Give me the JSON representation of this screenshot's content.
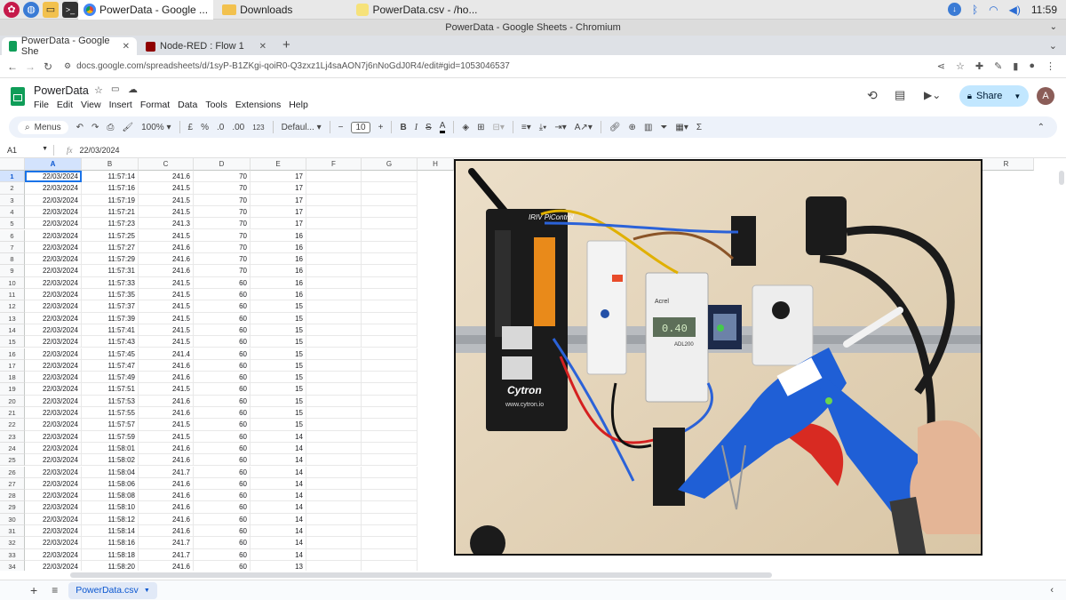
{
  "taskbar": {
    "tasks": [
      {
        "label": "PowerData - Google ...",
        "active": true
      },
      {
        "label": "Downloads",
        "active": false
      },
      {
        "label": "PowerData.csv - /ho...",
        "active": false
      }
    ],
    "clock": "11:59"
  },
  "window": {
    "title": "PowerData - Google Sheets - Chromium"
  },
  "tabs": [
    {
      "label": "PowerData - Google She",
      "active": true
    },
    {
      "label": "Node-RED : Flow 1",
      "active": false
    }
  ],
  "address": {
    "url": "docs.google.com/spreadsheets/d/1syP-B1ZKgi-qoiR0-Q3zxz1Lj4saAON7j6nNoGdJ0R4/edit#gid=1053046537"
  },
  "sheets": {
    "title": "PowerData",
    "menus": [
      "File",
      "Edit",
      "View",
      "Insert",
      "Format",
      "Data",
      "Tools",
      "Extensions",
      "Help"
    ],
    "share_label": "Share",
    "avatar_letter": "A"
  },
  "toolbar": {
    "menus_label": "Menus",
    "zoom": "100%",
    "currency": "£",
    "percent": "%",
    "dec_decrease": ".0",
    "dec_increase": ".00",
    "number_format": "123",
    "font": "Defaul...",
    "font_size": "10"
  },
  "formula": {
    "cell_ref": "A1",
    "value": "22/03/2024"
  },
  "grid": {
    "columns": [
      "A",
      "B",
      "C",
      "D",
      "E",
      "F",
      "G",
      "H",
      "R"
    ],
    "rows": [
      [
        "22/03/2024",
        "11:57:14",
        "241.6",
        "70",
        "17"
      ],
      [
        "22/03/2024",
        "11:57:16",
        "241.5",
        "70",
        "17"
      ],
      [
        "22/03/2024",
        "11:57:19",
        "241.5",
        "70",
        "17"
      ],
      [
        "22/03/2024",
        "11:57:21",
        "241.5",
        "70",
        "17"
      ],
      [
        "22/03/2024",
        "11:57:23",
        "241.3",
        "70",
        "17"
      ],
      [
        "22/03/2024",
        "11:57:25",
        "241.5",
        "70",
        "16"
      ],
      [
        "22/03/2024",
        "11:57:27",
        "241.6",
        "70",
        "16"
      ],
      [
        "22/03/2024",
        "11:57:29",
        "241.6",
        "70",
        "16"
      ],
      [
        "22/03/2024",
        "11:57:31",
        "241.6",
        "70",
        "16"
      ],
      [
        "22/03/2024",
        "11:57:33",
        "241.5",
        "60",
        "16"
      ],
      [
        "22/03/2024",
        "11:57:35",
        "241.5",
        "60",
        "16"
      ],
      [
        "22/03/2024",
        "11:57:37",
        "241.5",
        "60",
        "15"
      ],
      [
        "22/03/2024",
        "11:57:39",
        "241.5",
        "60",
        "15"
      ],
      [
        "22/03/2024",
        "11:57:41",
        "241.5",
        "60",
        "15"
      ],
      [
        "22/03/2024",
        "11:57:43",
        "241.5",
        "60",
        "15"
      ],
      [
        "22/03/2024",
        "11:57:45",
        "241.4",
        "60",
        "15"
      ],
      [
        "22/03/2024",
        "11:57:47",
        "241.6",
        "60",
        "15"
      ],
      [
        "22/03/2024",
        "11:57:49",
        "241.6",
        "60",
        "15"
      ],
      [
        "22/03/2024",
        "11:57:51",
        "241.5",
        "60",
        "15"
      ],
      [
        "22/03/2024",
        "11:57:53",
        "241.6",
        "60",
        "15"
      ],
      [
        "22/03/2024",
        "11:57:55",
        "241.6",
        "60",
        "15"
      ],
      [
        "22/03/2024",
        "11:57:57",
        "241.5",
        "60",
        "15"
      ],
      [
        "22/03/2024",
        "11:57:59",
        "241.5",
        "60",
        "14"
      ],
      [
        "22/03/2024",
        "11:58:01",
        "241.6",
        "60",
        "14"
      ],
      [
        "22/03/2024",
        "11:58:02",
        "241.6",
        "60",
        "14"
      ],
      [
        "22/03/2024",
        "11:58:04",
        "241.7",
        "60",
        "14"
      ],
      [
        "22/03/2024",
        "11:58:06",
        "241.6",
        "60",
        "14"
      ],
      [
        "22/03/2024",
        "11:58:08",
        "241.6",
        "60",
        "14"
      ],
      [
        "22/03/2024",
        "11:58:10",
        "241.6",
        "60",
        "14"
      ],
      [
        "22/03/2024",
        "11:58:12",
        "241.6",
        "60",
        "14"
      ],
      [
        "22/03/2024",
        "11:58:14",
        "241.6",
        "60",
        "14"
      ],
      [
        "22/03/2024",
        "11:58:16",
        "241.7",
        "60",
        "14"
      ],
      [
        "22/03/2024",
        "11:58:18",
        "241.7",
        "60",
        "14"
      ],
      [
        "22/03/2024",
        "11:58:20",
        "241.6",
        "60",
        "13"
      ]
    ]
  },
  "photo_labels": {
    "brand": "Cytron",
    "site": "www.cytron.io",
    "controller": "IRIV PiControl",
    "meter": "Acrel",
    "meter_model": "ADL200",
    "meter_reading": "0.40"
  },
  "sheet_tabs": [
    {
      "label": "PowerData.csv"
    }
  ],
  "colors": {
    "accent": "#1a73e8",
    "share_bg": "#c2e7ff",
    "toolbar_bg": "#edf2fa",
    "gun_blue": "#1f5fd6"
  }
}
